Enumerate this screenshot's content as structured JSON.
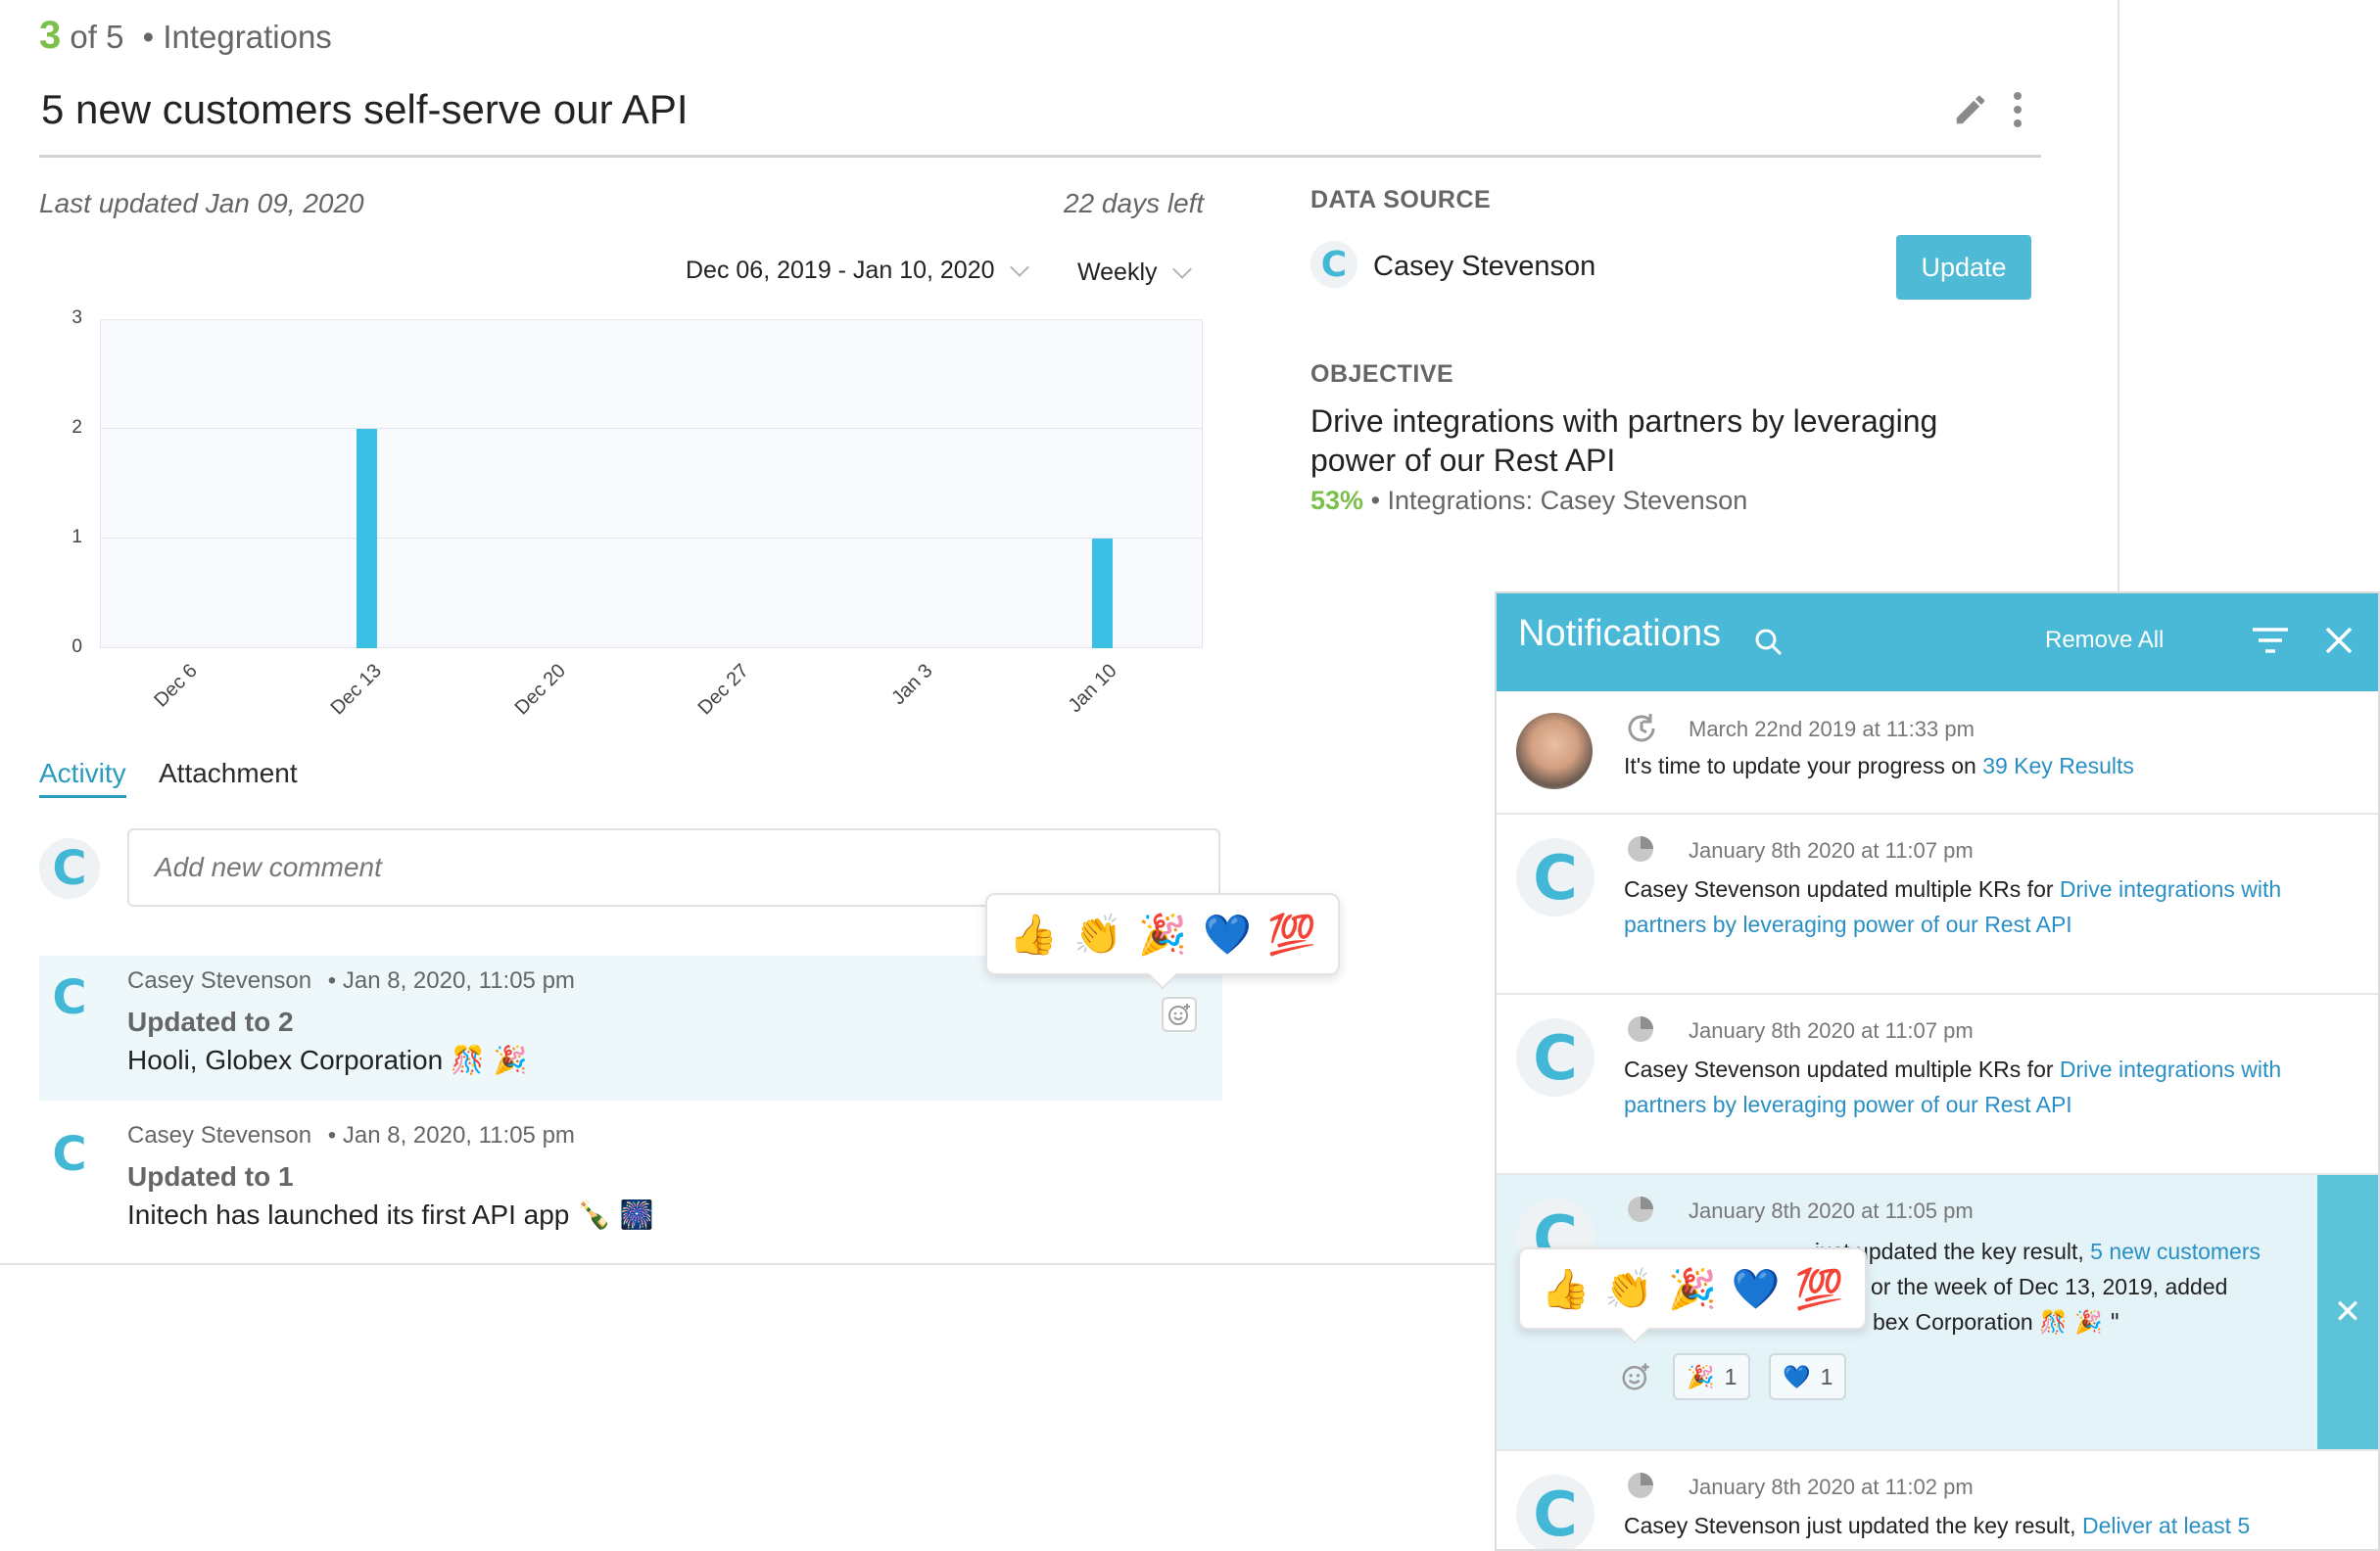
{
  "header": {
    "step_current": "3",
    "step_of": "of 5",
    "section": "• Integrations",
    "title": "5 new customers self-serve our API"
  },
  "meta": {
    "last_updated": "Last updated Jan 09, 2020",
    "days_left": "22 days left",
    "date_range": "Dec 06, 2019 - Jan 10, 2020",
    "interval": "Weekly"
  },
  "chart_data": {
    "type": "bar",
    "categories": [
      "Dec 6",
      "Dec 13",
      "Dec 20",
      "Dec 27",
      "Jan 3",
      "Jan 10"
    ],
    "values": [
      0,
      2,
      0,
      0,
      0,
      1
    ],
    "yticks": [
      "3",
      "2",
      "1",
      "0"
    ],
    "ylim": [
      0,
      3
    ],
    "grid": true,
    "color": "#3bbfe5"
  },
  "tabs": {
    "activity": "Activity",
    "attachment": "Attachment"
  },
  "comment": {
    "placeholder": "Add new comment"
  },
  "activity": [
    {
      "author": "Casey Stevenson",
      "time": "• Jan 8, 2020, 11:05 pm",
      "update": "Updated to 2",
      "message": "Hooli, Globex Corporation",
      "emojis": "🎊 🎉"
    },
    {
      "author": "Casey Stevenson",
      "time": "• Jan 8, 2020, 11:05 pm",
      "update": "Updated to 1",
      "message": "Initech has launched its first API app",
      "emojis": "🍾 🎆"
    }
  ],
  "reactions": [
    "👍",
    "👏",
    "🎉",
    "💙",
    "💯"
  ],
  "data_source": {
    "label": "DATA SOURCE",
    "owner": "Casey Stevenson",
    "update_button": "Update"
  },
  "objective": {
    "label": "OBJECTIVE",
    "text": "Drive integrations with partners by leveraging power of our Rest API",
    "percent": "53%",
    "sub": "• Integrations: Casey Stevenson"
  },
  "notifications": {
    "title": "Notifications",
    "remove_all": "Remove All",
    "items": [
      {
        "time": "March 22nd 2019 at 11:33 pm",
        "text": "It's time to update your progress on ",
        "link": "39 Key Results"
      },
      {
        "time": "January 8th 2020 at 11:07 pm",
        "text": "Casey Stevenson updated multiple KRs for ",
        "link": "Drive integrations with partners by leveraging power of our Rest API"
      },
      {
        "time": "January 8th 2020 at 11:07 pm",
        "text": "Casey Stevenson updated multiple KRs for ",
        "link": "Drive integrations with partners by leveraging power of our Rest API"
      },
      {
        "time": "January 8th 2020 at 11:05 pm",
        "line1_hidden": "Casey Stevenson just updated the key result, ",
        "line1": "just updated the key result, ",
        "link": "5 new customers",
        "line2": "or the week of Dec 13, 2019, added",
        "line3": "bex Corporation",
        "line3_emoji": "🎊 🎉 \"",
        "chip1_emoji": "🎉",
        "chip1_count": "1",
        "chip2_emoji": "💙",
        "chip2_count": "1"
      },
      {
        "time": "January 8th 2020 at 11:02 pm",
        "text": "Casey Stevenson just updated the key result, ",
        "link": "Deliver at least 5"
      }
    ]
  }
}
